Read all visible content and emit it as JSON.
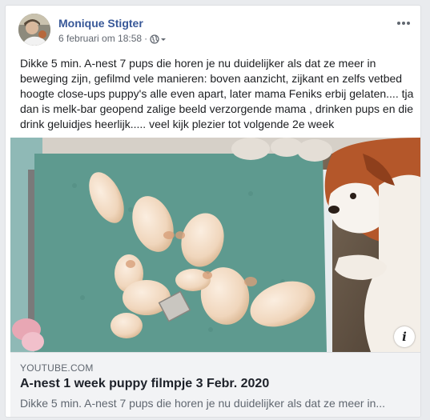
{
  "post": {
    "author": "Monique Stigter",
    "timestamp": "6 februari om 18:58",
    "separator": "·",
    "privacy_icon": "globe-icon",
    "privacy_dropdown_icon": "chevron-down-icon",
    "more_icon": "ellipsis-icon",
    "text": "Dikke 5 min. A-nest 7 pups die horen je nu duidelijker als dat ze meer in beweging zijn, gefilmd vele manieren: boven aanzicht, zijkant en zelfs vetbed hoogte close-ups puppy's alle even apart, later mama Feniks erbij gelaten.... tja dan is melk-bar geopend zalige beeld verzorgende mama , drinken pups en die drink geluidjes heerlijk..... veel kijk plezier tot volgende 2e week"
  },
  "media": {
    "info_label": "i",
    "info_icon": "info-icon"
  },
  "link": {
    "domain": "YOUTUBE.COM",
    "title": "A-nest 1 week puppy filmpje 3 Febr. 2020",
    "description": "Dikke 5 min. A-nest 7 pups die horen je nu duidelijker als dat ze meer in..."
  },
  "colors": {
    "author_link": "#385898",
    "meta_text": "#616770",
    "body_text": "#1c1e21",
    "page_bg": "#e9ebee",
    "link_box_bg": "#f2f3f5",
    "blanket": "#5e9a8f"
  }
}
